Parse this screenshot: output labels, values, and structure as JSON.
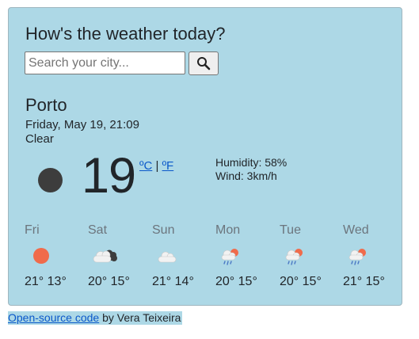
{
  "header": {
    "title": "How's the weather today?"
  },
  "search": {
    "placeholder": "Search your city..."
  },
  "current": {
    "city": "Porto",
    "datetime": "Friday, May 19, 21:09",
    "description": "Clear",
    "temperature": "19",
    "unit_c": "ºC",
    "unit_sep": "|",
    "unit_f": "ºF",
    "humidity": "Humidity: 58%",
    "wind": "Wind: 3km/h",
    "icon": "clear-night-icon"
  },
  "forecast": [
    {
      "day": "Fri",
      "temps": "21° 13°",
      "icon": "sun-icon"
    },
    {
      "day": "Sat",
      "temps": "20° 15°",
      "icon": "cloudy-icon"
    },
    {
      "day": "Sun",
      "temps": "21° 14°",
      "icon": "cloud-icon"
    },
    {
      "day": "Mon",
      "temps": "20° 15°",
      "icon": "rain-icon"
    },
    {
      "day": "Tue",
      "temps": "20° 15°",
      "icon": "rain-icon"
    },
    {
      "day": "Wed",
      "temps": "21° 15°",
      "icon": "rain-icon"
    }
  ],
  "footer": {
    "link_text": "Open-source code",
    "byline": " by Vera Teixeira"
  },
  "colors": {
    "card_bg": "#add8e6",
    "link": "#0a58ca",
    "sun": "#f06b4b",
    "cloud": "#f2f2f2",
    "dark_cloud": "#3d3d3d",
    "rain": "#4a78c4"
  }
}
